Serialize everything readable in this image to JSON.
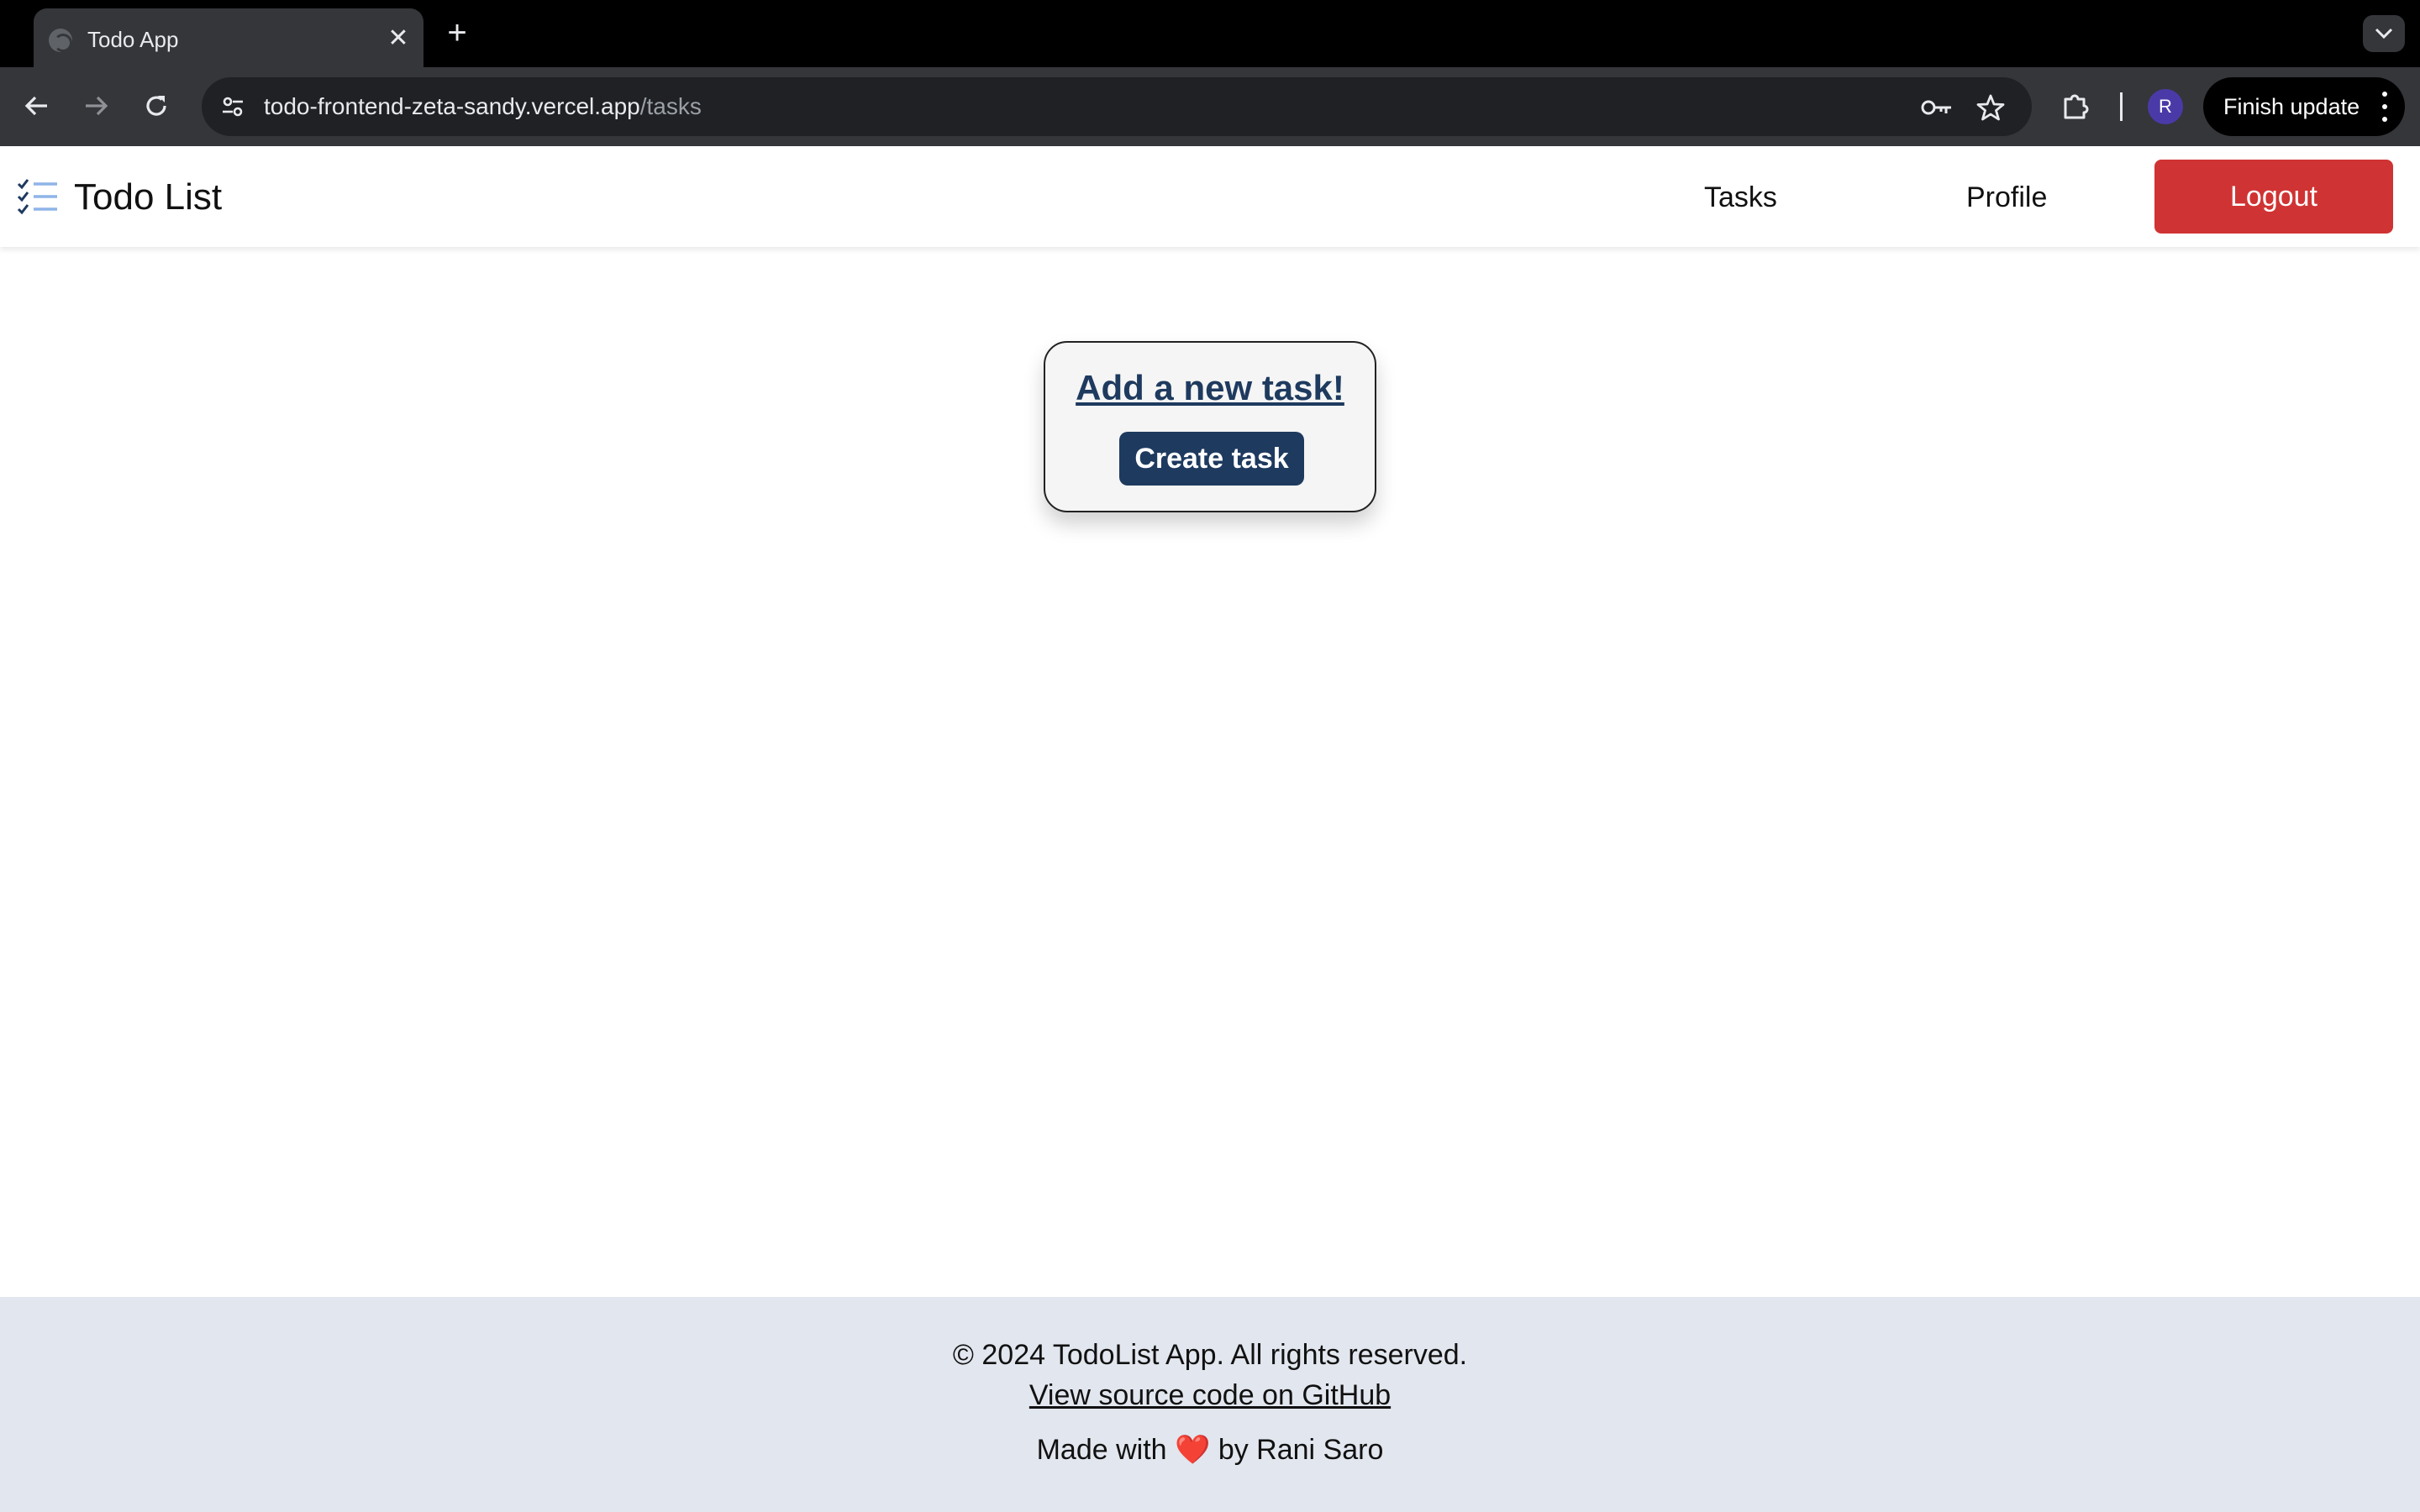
{
  "browser": {
    "tab_title": "Todo App",
    "tab_close": "✕",
    "new_tab": "+",
    "url_host": "todo-frontend-zeta-sandy.vercel.app",
    "url_path": "/tasks",
    "profile_initial": "R",
    "finish_update_label": "Finish update",
    "icons": {
      "back": "arrow-left-icon",
      "forward": "arrow-right-icon",
      "reload": "reload-icon",
      "site_info": "tune-icon",
      "password": "key-icon",
      "bookmark": "star-icon",
      "extensions": "puzzle-icon",
      "menu": "kebab-menu-icon",
      "tab_search": "chevron-down-icon"
    }
  },
  "app": {
    "brand": {
      "title": "Todo List",
      "icon": "checklist-icon"
    },
    "nav": {
      "tasks_label": "Tasks",
      "profile_label": "Profile",
      "logout_label": "Logout"
    },
    "card": {
      "heading": "Add a new task!",
      "button_label": "Create task"
    },
    "footer": {
      "copyright": "© 2024 TodoList App. All rights reserved.",
      "source_link": "View source code on GitHub",
      "made_with_prefix": "Made with",
      "heart": "❤️",
      "made_with_suffix": "by Rani Saro"
    }
  },
  "colors": {
    "logout_bg": "#d03333",
    "primary": "#1e3a5f",
    "footer_bg": "#e2e6ee",
    "browser_bg": "#35363a"
  }
}
